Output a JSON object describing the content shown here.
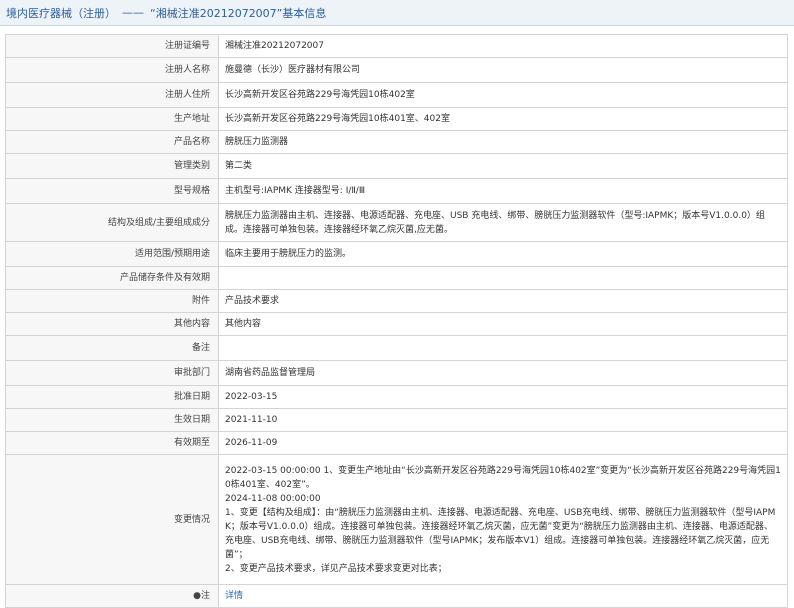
{
  "header": {
    "section": "境内医疗器械（注册）",
    "separator": "——",
    "title": "“湘械注准20212072007”基本信息"
  },
  "rows": [
    {
      "label": "注册证编号",
      "value": "湘械注准20212072007"
    },
    {
      "label": "注册人名称",
      "value": "施曼德（长沙）医疗器材有限公司"
    },
    {
      "label": "注册人住所",
      "value": "长沙高新开发区谷苑路229号海凭园10栋402室"
    },
    {
      "label": "生产地址",
      "value": "长沙高新开发区谷苑路229号海凭园10栋401室、402室"
    },
    {
      "label": "产品名称",
      "value": "膀胱压力监测器"
    },
    {
      "label": "管理类别",
      "value": "第二类"
    },
    {
      "label": "型号规格",
      "value": "主机型号:IAPMK 连接器型号: Ⅰ/Ⅱ/Ⅲ"
    },
    {
      "label": "结构及组成/主要组成成分",
      "value": "膀胱压力监测器由主机、连接器、电源适配器、充电座、USB 充电线、绑带、膀胱压力监测器软件（型号:IAPMK；版本号V1.0.0.0）组成。连接器可单独包装。连接器经环氧乙烷灭菌,应无菌。"
    },
    {
      "label": "适用范围/预期用途",
      "value": "临床主要用于膀胱压力的监测。"
    },
    {
      "label": "产品储存条件及有效期",
      "value": ""
    },
    {
      "label": "附件",
      "value": "产品技术要求"
    },
    {
      "label": "其他内容",
      "value": "其他内容"
    },
    {
      "label": "备注",
      "value": ""
    },
    {
      "label": "审批部门",
      "value": "湖南省药品监督管理局"
    },
    {
      "label": "批准日期",
      "value": "2022-03-15"
    },
    {
      "label": "生效日期",
      "value": "2021-11-10"
    },
    {
      "label": "有效期至",
      "value": "2026-11-09"
    }
  ],
  "changes": {
    "label": "变更情况",
    "lines": [
      "2022-03-15 00:00:00 1、变更生产地址由“长沙高新开发区谷苑路229号海凭园10栋402室”变更为“长沙高新开发区谷苑路229号海凭园10栋401室、402室”。",
      "2024-11-08 00:00:00",
      "1、变更【结构及组成】：由“膀胱压力监测器由主机、连接器、电源适配器、充电座、USB充电线、绑带、膀胱压力监测器软件（型号IAPMK；版本号V1.0.0.0）组成。连接器可单独包装。连接器经环氧乙烷灭菌，应无菌”变更为“膀胱压力监测器由主机、连接器、电源适配器、充电座、USB充电线、绑带、膀胱压力监测器软件（型号IAPMK；发布版本V1）组成。连接器可单独包装。连接器经环氧乙烷灭菌，应无菌”；",
      "2、变更产品技术要求，详见产品技术要求变更对比表；"
    ]
  },
  "note": {
    "label": "注",
    "link": "详情"
  }
}
